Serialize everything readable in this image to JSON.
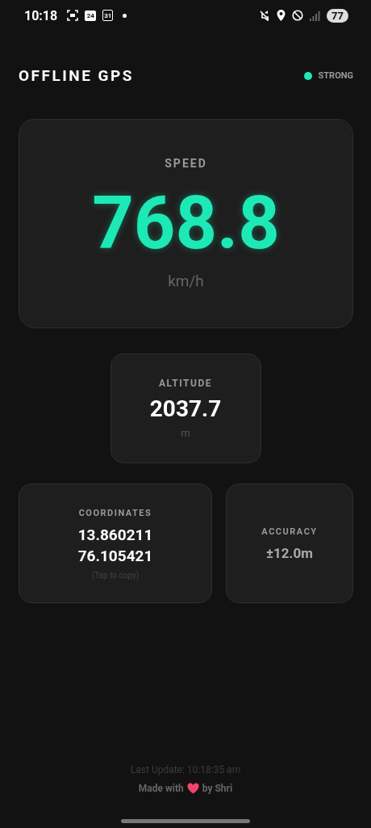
{
  "status_bar": {
    "time": "10:18",
    "notifications": [
      {
        "kind": "screenshot"
      },
      {
        "kind": "calendar",
        "text": "24"
      },
      {
        "kind": "date",
        "text": "31"
      },
      {
        "kind": "dot"
      }
    ],
    "battery": "77"
  },
  "header": {
    "title": "OFFLINE GPS",
    "signal": {
      "label": "STRONG",
      "color": "#1de9b6"
    }
  },
  "speed": {
    "label": "SPEED",
    "value": "768.8",
    "unit": "km/h"
  },
  "altitude": {
    "label": "ALTITUDE",
    "value": "2037.7",
    "unit": "m"
  },
  "coordinates": {
    "label": "COORDINATES",
    "lines": [
      "13.860211",
      "76.105421"
    ],
    "hint": "(Tap to copy)"
  },
  "accuracy": {
    "label": "ACCURACY",
    "value": "±12.0m"
  },
  "footer": {
    "last_update": "Last Update: 10:18:35 am",
    "made_with": "Made with",
    "by": "by Shri"
  }
}
